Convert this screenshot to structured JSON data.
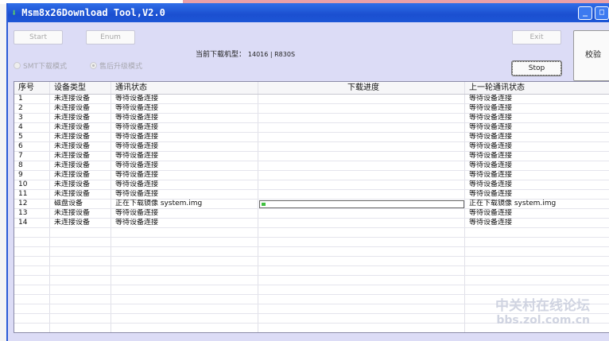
{
  "window": {
    "title": "Msm8x26Download Tool,V2.0"
  },
  "buttons": {
    "start": "Start",
    "enum": "Enum",
    "exit": "Exit",
    "stop": "Stop",
    "verify": "校验"
  },
  "model": {
    "label": "当前下载机型：",
    "value": "14016 | R830S"
  },
  "modes": [
    {
      "label": "SMT下载模式",
      "selected": false
    },
    {
      "label": "售后升级模式",
      "selected": true
    }
  ],
  "table": {
    "headers": [
      "序号",
      "设备类型",
      "通讯状态",
      "下载进度",
      "上一轮通讯状态"
    ],
    "rows": [
      {
        "no": "1",
        "type": "未连接设备",
        "status": "等待设备连接",
        "prev": "等待设备连接"
      },
      {
        "no": "2",
        "type": "未连接设备",
        "status": "等待设备连接",
        "prev": "等待设备连接"
      },
      {
        "no": "3",
        "type": "未连接设备",
        "status": "等待设备连接",
        "prev": "等待设备连接"
      },
      {
        "no": "4",
        "type": "未连接设备",
        "status": "等待设备连接",
        "prev": "等待设备连接"
      },
      {
        "no": "5",
        "type": "未连接设备",
        "status": "等待设备连接",
        "prev": "等待设备连接"
      },
      {
        "no": "6",
        "type": "未连接设备",
        "status": "等待设备连接",
        "prev": "等待设备连接"
      },
      {
        "no": "7",
        "type": "未连接设备",
        "status": "等待设备连接",
        "prev": "等待设备连接"
      },
      {
        "no": "8",
        "type": "未连接设备",
        "status": "等待设备连接",
        "prev": "等待设备连接"
      },
      {
        "no": "9",
        "type": "未连接设备",
        "status": "等待设备连接",
        "prev": "等待设备连接"
      },
      {
        "no": "10",
        "type": "未连接设备",
        "status": "等待设备连接",
        "prev": "等待设备连接"
      },
      {
        "no": "11",
        "type": "未连接设备",
        "status": "等待设备连接",
        "prev": "等待设备连接"
      },
      {
        "no": "12",
        "type": "磁盘设备",
        "status": "正在下载镜像 system.img",
        "prev": "正在下载镜像 system.img",
        "progress": 0.02
      },
      {
        "no": "13",
        "type": "未连接设备",
        "status": "等待设备连接",
        "prev": "等待设备连接"
      },
      {
        "no": "14",
        "type": "未连接设备",
        "status": "等待设备连接",
        "prev": "等待设备连接"
      }
    ]
  },
  "watermark": {
    "line1": "中关村在线论坛",
    "line2": "bbs.zol.com.cn"
  }
}
